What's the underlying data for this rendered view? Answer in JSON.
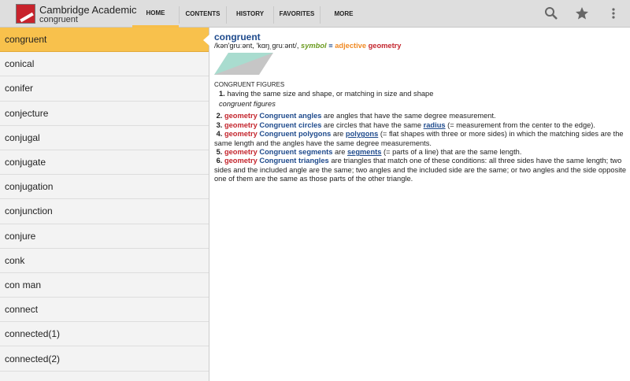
{
  "header": {
    "app_title": "Cambridge Academic",
    "current_word": "congruent",
    "tabs": [
      "HOME",
      "CONTENTS",
      "HISTORY",
      "FAVORITES",
      "MORE"
    ],
    "icons": [
      "search-icon",
      "star-icon",
      "overflow-menu-icon"
    ]
  },
  "sidebar": {
    "items": [
      "congruent",
      "conical",
      "conifer",
      "conjecture",
      "conjugal",
      "conjugate",
      "conjugation",
      "conjunction",
      "conjure",
      "conk",
      "con man",
      "connect",
      "connected(1)",
      "connected(2)"
    ]
  },
  "entry": {
    "headword": "congruent",
    "pron": "/kən'gruːənt, 'kɑŋˌgruːənt/,",
    "symbol": "symbol",
    "symbol_mark": "≡",
    "pos": "adjective",
    "domain": "geometry",
    "section": "CONGRUENT FIGURES",
    "sense1_num": "1.",
    "sense1": "having the same size and shape, or matching in size and shape",
    "example": "congruent figures",
    "senses": [
      {
        "num": "2.",
        "domain": "geometry",
        "term": "Congruent angles",
        "text": " are angles that have the same degree measurement."
      },
      {
        "num": "3.",
        "domain": "geometry",
        "term": "Congruent circles",
        "text": " are circles that have the same ",
        "link": "radius",
        "after": " (= measurement from the center to the edge)."
      },
      {
        "num": "4.",
        "domain": "geometry",
        "term": "Congruent polygons",
        "text": " are ",
        "link": "polygons",
        "after": " (= flat shapes with three or more sides) in which the matching sides are the same length and the angles have the same degree measurements."
      },
      {
        "num": "5.",
        "domain": "geometry",
        "term": "Congruent segments",
        "text": " are ",
        "link": "segments",
        "after": " (= parts of a line) that are the same length."
      },
      {
        "num": "6.",
        "domain": "geometry",
        "term": "Congruent triangles",
        "text": " are triangles that match one of these conditions: all three sides have the same length; two sides and the included angle are the same; two angles and the included side are the same; or two angles and the side opposite one of them are the same as those parts of the other triangle."
      }
    ]
  }
}
